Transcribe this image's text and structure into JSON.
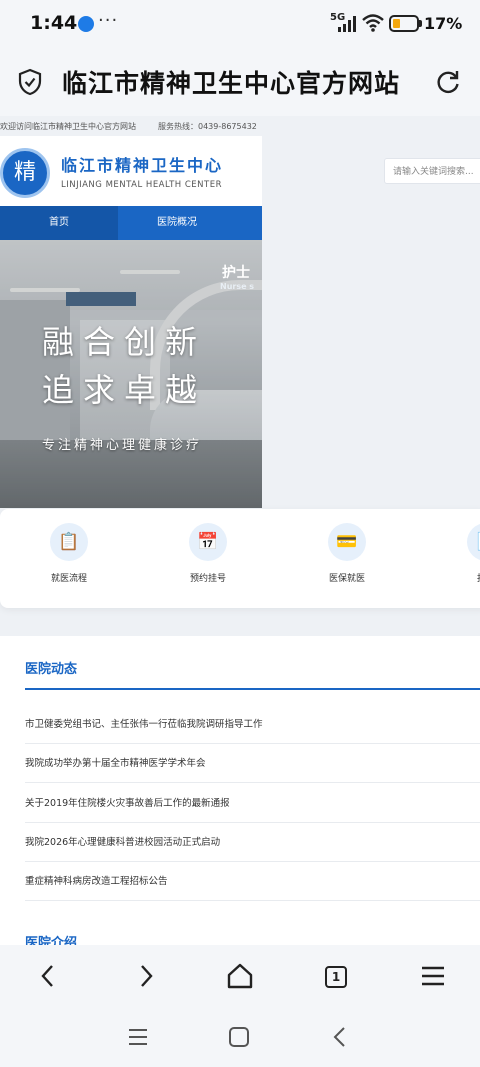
{
  "status_bar": {
    "time": "1:44",
    "more": "···",
    "network": "5G",
    "battery_pct": "17%",
    "battery_level": 0.17,
    "battery_color": "#f3a70f"
  },
  "browser": {
    "page_title": "临江市精神卫生中心官方网站"
  },
  "site": {
    "welcome": "欢迎访问临江市精神卫生中心官方网站",
    "hotline": "服务热线：0439-8675432",
    "logo_char": "精",
    "name_cn": "临江市精神卫生中心",
    "name_en": "LINJIANG MENTAL HEALTH CENTER",
    "search_placeholder": "请输入关键词搜索...",
    "brand_color": "#1a66c4",
    "nav": [
      {
        "label": "首页"
      },
      {
        "label": "医院概况"
      }
    ],
    "hero": {
      "nurse_sign": "护士",
      "nurse_sign_en": "Nurse s",
      "slogan": "融合创新 追求卓越",
      "subslogan": "专注精神心理健康诊疗"
    },
    "quick_links": [
      {
        "label": "就医流程",
        "icon": "clipboard-icon",
        "glyph": "📋"
      },
      {
        "label": "预约挂号",
        "icon": "calendar-icon",
        "glyph": "📅"
      },
      {
        "label": "医保就医",
        "icon": "card-icon",
        "glyph": "💳"
      },
      {
        "label": "报告",
        "icon": "report-icon",
        "glyph": "📄"
      }
    ],
    "news": {
      "heading": "医院动态",
      "items": [
        "市卫健委党组书记、主任张伟一行莅临我院调研指导工作",
        "我院成功举办第十届全市精神医学学术年会",
        "关于2019年住院楼火灾事故善后工作的最新通报",
        "我院2026年心理健康科普进校园活动正式启动",
        "重症精神科病房改造工程招标公告"
      ]
    },
    "intro_heading": "医院介绍"
  },
  "toolbar": {
    "tab_count": "1"
  }
}
